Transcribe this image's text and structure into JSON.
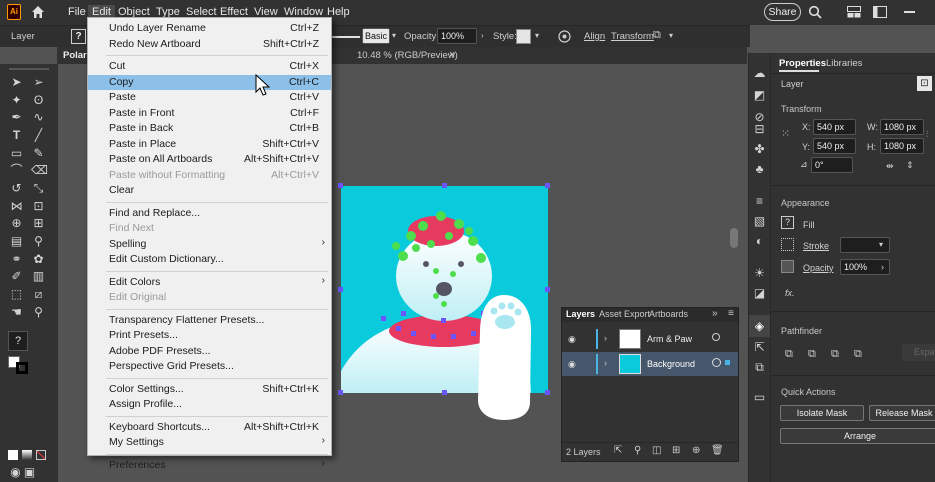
{
  "app": {
    "logo": "Ai",
    "menus": [
      "File",
      "Edit",
      "Object",
      "Type",
      "Select",
      "Effect",
      "View",
      "Window",
      "Help"
    ],
    "active_menu": "Edit",
    "share_label": "Share"
  },
  "control_bar": {
    "selection_label": "Layer",
    "style_preset": "Basic",
    "opacity_label": "Opacity:",
    "opacity_value": "100%",
    "style_label": "Style:",
    "align_label": "Align",
    "transform_label": "Transform"
  },
  "document_tab": {
    "title_start": "Polar",
    "title_end": "10.48 % (RGB/Preview)",
    "close": "×"
  },
  "edit_menu": [
    {
      "label": "Undo Layer Rename",
      "shortcut": "Ctrl+Z"
    },
    {
      "label": "Redo New Artboard",
      "shortcut": "Shift+Ctrl+Z"
    },
    {
      "sep": true
    },
    {
      "label": "Cut",
      "shortcut": "Ctrl+X"
    },
    {
      "label": "Copy",
      "shortcut": "Ctrl+C",
      "highlight": true
    },
    {
      "label": "Paste",
      "shortcut": "Ctrl+V"
    },
    {
      "label": "Paste in Front",
      "shortcut": "Ctrl+F"
    },
    {
      "label": "Paste in Back",
      "shortcut": "Ctrl+B"
    },
    {
      "label": "Paste in Place",
      "shortcut": "Shift+Ctrl+V"
    },
    {
      "label": "Paste on All Artboards",
      "shortcut": "Alt+Shift+Ctrl+V"
    },
    {
      "label": "Paste without Formatting",
      "shortcut": "Alt+Ctrl+V",
      "disabled": true
    },
    {
      "label": "Clear",
      "shortcut": ""
    },
    {
      "sep": true
    },
    {
      "label": "Find and Replace...",
      "shortcut": ""
    },
    {
      "label": "Find Next",
      "shortcut": "",
      "disabled": true
    },
    {
      "label": "Spelling",
      "shortcut": "",
      "submenu": true
    },
    {
      "label": "Edit Custom Dictionary...",
      "shortcut": ""
    },
    {
      "sep": true
    },
    {
      "label": "Edit Colors",
      "shortcut": "",
      "submenu": true
    },
    {
      "label": "Edit Original",
      "shortcut": "",
      "disabled": true
    },
    {
      "sep": true
    },
    {
      "label": "Transparency Flattener Presets...",
      "shortcut": ""
    },
    {
      "label": "Print Presets...",
      "shortcut": ""
    },
    {
      "label": "Adobe PDF Presets...",
      "shortcut": ""
    },
    {
      "label": "Perspective Grid Presets...",
      "shortcut": ""
    },
    {
      "sep": true
    },
    {
      "label": "Color Settings...",
      "shortcut": "Shift+Ctrl+K"
    },
    {
      "label": "Assign Profile...",
      "shortcut": ""
    },
    {
      "sep": true
    },
    {
      "label": "Keyboard Shortcuts...",
      "shortcut": "Alt+Shift+Ctrl+K"
    },
    {
      "label": "My Settings",
      "shortcut": "",
      "submenu": true
    },
    {
      "sep": true
    },
    {
      "label": "Preferences",
      "shortcut": "",
      "submenu": true
    }
  ],
  "properties": {
    "tabs": [
      "Properties",
      "Libraries"
    ],
    "layer_heading": "Layer",
    "transform_heading": "Transform",
    "x_label": "X:",
    "x_value": "540 px",
    "y_label": "Y:",
    "y_value": "540 px",
    "w_label": "W:",
    "w_value": "1080 px",
    "h_label": "H:",
    "h_value": "1080 px",
    "rotate_value": "0°",
    "appearance_heading": "Appearance",
    "fill_label": "Fill",
    "stroke_label": "Stroke",
    "opacity_label": "Opacity",
    "opacity_value": "100%",
    "fx_label": "fx.",
    "pathfinder_heading": "Pathfinder",
    "expand_label": "Expan",
    "quick_actions_heading": "Quick Actions",
    "isolate_mask": "Isolate Mask",
    "release_mask": "Release Mask",
    "arrange": "Arrange"
  },
  "layers_panel": {
    "tabs": [
      "Layers",
      "Asset Export",
      "Artboards"
    ],
    "rows": [
      "Arm & Paw",
      "Background"
    ],
    "count": "2 Layers"
  },
  "colors": {
    "artboard": "#09cbdc",
    "menu_highlight": "#8cc0e9",
    "selection": "#6b55ff",
    "layer_color": "#4bb4e6"
  }
}
